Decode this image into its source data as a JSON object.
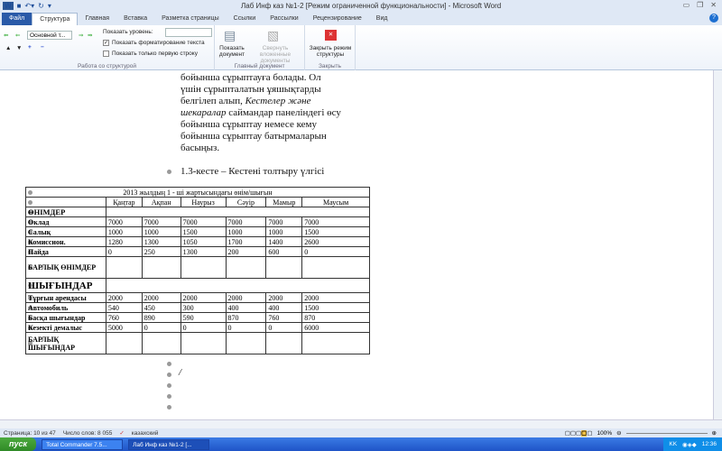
{
  "window": {
    "title": "Лаб Инф каз №1-2 [Режим ограниченной функциональности] - Microsoft Word",
    "app_icon": "W"
  },
  "tabs": [
    "Файл",
    "Структура",
    "Главная",
    "Вставка",
    "Разметка страницы",
    "Ссылки",
    "Рассылки",
    "Рецензирование",
    "Вид"
  ],
  "ribbon": {
    "outline": {
      "level_select": "Основной т...",
      "show_level_label": "Показать уровень:",
      "show_formatting": "Показать форматирование текста",
      "show_first_line": "Показать только первую строку",
      "group_label": "Работа со структурой"
    },
    "master": {
      "show_doc": "Показать документ",
      "collapse": "Свернуть вложенные документы",
      "group_label": "Главный документ"
    },
    "close": {
      "close_outline": "Закрыть режим структуры",
      "group_label": "Закрыть"
    }
  },
  "document": {
    "paragraph_plain": "бойынша сұрыптауға болады. Ол үшін сұрыпталатын ұяшықтарды белгілеп алып, ",
    "paragraph_italic": "Кестелер және шекаралар",
    "paragraph_rest": " саймандар панеліндегі өсу бойынша сұрыптау немесе кему бойынша сұрыптау батырмаларын басыңыз.",
    "caption": "1.3-кесте – Кестені толтыру үлгісі",
    "cursor_text": "/",
    "table": {
      "title": "2013 жылдың 1 - ші жартысындағы өнім/шығын",
      "headers": [
        "",
        "Қаңтар",
        "Ақпан",
        "Наурыз",
        "Сәуір",
        "Мамыр",
        "Маусым"
      ],
      "rows": [
        {
          "label": "ӨНІМДЕР",
          "section": true,
          "values": []
        },
        {
          "label": "Оклад",
          "values": [
            "7000",
            "7000",
            "7000",
            "7000",
            "7000",
            "7000"
          ]
        },
        {
          "label": "Салық",
          "values": [
            "1000",
            "1000",
            "1500",
            "1000",
            "1000",
            "1500"
          ]
        },
        {
          "label": "Комиссион.",
          "values": [
            "1280",
            "1300",
            "1050",
            "1700",
            "1400",
            "2600"
          ]
        },
        {
          "label": "Пайда",
          "values": [
            "0",
            "250",
            "1300",
            "200",
            "600",
            "0"
          ]
        },
        {
          "label": "БАРЛЫҚ ӨНІМДЕР",
          "values": [
            "",
            "",
            "",
            "",
            "",
            ""
          ]
        },
        {
          "label": "ШЫҒЫНДАР",
          "section": true,
          "values": []
        },
        {
          "label": "Тұрғын арендасы",
          "values": [
            "2000",
            "2000",
            "2000",
            "2000",
            "2000",
            "2000"
          ]
        },
        {
          "label": "Автомобиль",
          "values": [
            "540",
            "450",
            "300",
            "400",
            "400",
            "1500"
          ]
        },
        {
          "label": "Басқа шығындар",
          "values": [
            "760",
            "890",
            "590",
            "870",
            "760",
            "870"
          ]
        },
        {
          "label": "Кезекті демалыс",
          "values": [
            "5000",
            "0",
            "0",
            "0",
            "0",
            "6000"
          ]
        },
        {
          "label": "БАРЛЫҚ ШЫҒЫНДАР",
          "values": [
            "",
            "",
            "",
            "",
            "",
            ""
          ]
        }
      ]
    }
  },
  "status": {
    "page": "Страница: 10 из 47",
    "words": "Число слов: 8 055",
    "language": "казахский",
    "zoom": "100%"
  },
  "taskbar": {
    "start": "пуск",
    "tasks": [
      "Total Commander 7.5...",
      "Лаб Инф каз №1-2 [..."
    ],
    "lang": "KK",
    "clock": "12:36"
  }
}
